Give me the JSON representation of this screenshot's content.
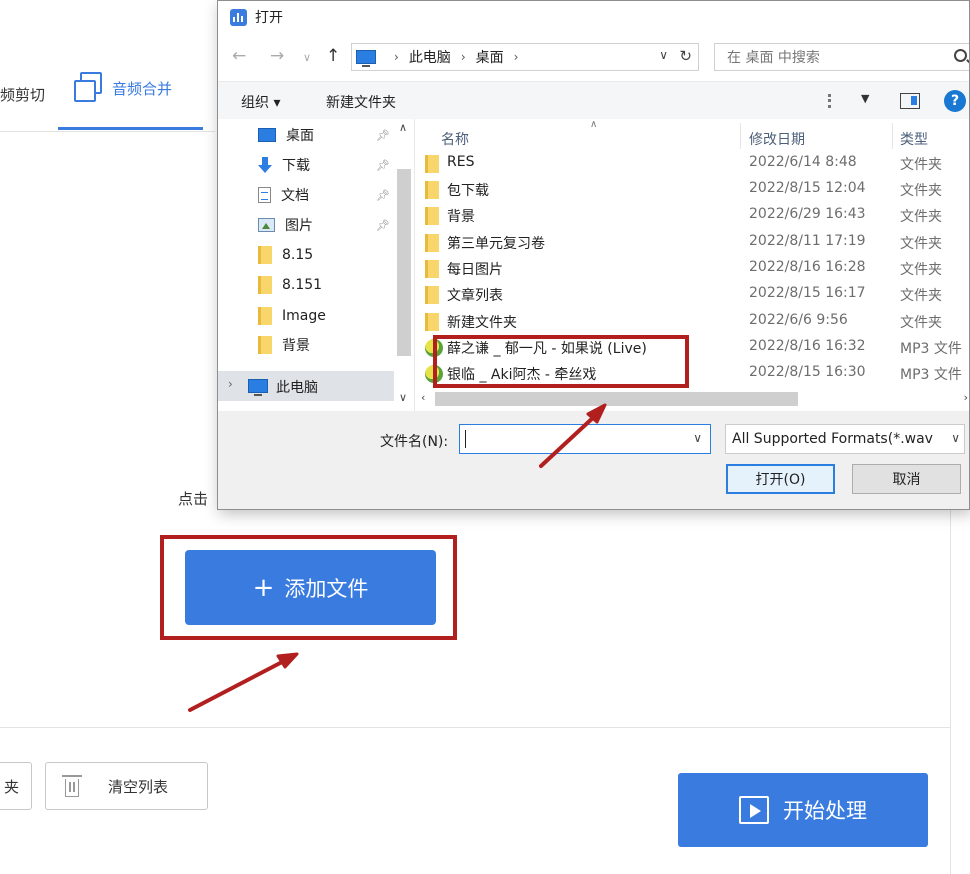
{
  "app": {
    "tab_left_label": "频剪切",
    "tab_merge_label": "音频合并",
    "click_hint": "点击",
    "add_file_label": "添加文件",
    "add_file_plus": "+",
    "folder_button_label": "夹",
    "clear_list_label": "清空列表",
    "start_label": "开始处理",
    "accent_color": "#3a7be0"
  },
  "dialog": {
    "title": "打开",
    "address": {
      "crumbs": [
        "此电脑",
        "桌面"
      ]
    },
    "search_placeholder": "在 桌面 中搜索",
    "toolbar": {
      "organize_label": "组织 ▾",
      "new_folder_label": "新建文件夹"
    },
    "nav_tree": [
      {
        "label": "桌面",
        "icon": "desktop-icon",
        "pinned": true
      },
      {
        "label": "下载",
        "icon": "download-icon",
        "pinned": true
      },
      {
        "label": "文档",
        "icon": "document-icon",
        "pinned": true
      },
      {
        "label": "图片",
        "icon": "pictures-icon",
        "pinned": true
      },
      {
        "label": "8.15",
        "icon": "folder-icon",
        "pinned": false
      },
      {
        "label": "8.151",
        "icon": "folder-icon",
        "pinned": false
      },
      {
        "label": "Image",
        "icon": "folder-icon",
        "pinned": false
      },
      {
        "label": "背景",
        "icon": "folder-icon",
        "pinned": false
      }
    ],
    "nav_this_pc": "此电脑",
    "columns": {
      "name": "名称",
      "modified": "修改日期",
      "type": "类型"
    },
    "files": [
      {
        "name": "RES",
        "modified": "2022/6/14 8:48",
        "type": "文件夹",
        "icon": "folder-icon"
      },
      {
        "name": "包下载",
        "modified": "2022/8/15 12:04",
        "type": "文件夹",
        "icon": "folder-icon"
      },
      {
        "name": "背景",
        "modified": "2022/6/29 16:43",
        "type": "文件夹",
        "icon": "folder-icon"
      },
      {
        "name": "第三单元复习卷",
        "modified": "2022/8/11 17:19",
        "type": "文件夹",
        "icon": "folder-icon"
      },
      {
        "name": "每日图片",
        "modified": "2022/8/16 16:28",
        "type": "文件夹",
        "icon": "folder-icon"
      },
      {
        "name": "文章列表",
        "modified": "2022/8/15 16:17",
        "type": "文件夹",
        "icon": "folder-icon"
      },
      {
        "name": "新建文件夹",
        "modified": "2022/6/6 9:56",
        "type": "文件夹",
        "icon": "folder-icon"
      },
      {
        "name": "薛之谦 _ 郁一凡 - 如果说 (Live)",
        "modified": "2022/8/16 16:32",
        "type": "MP3 文件",
        "icon": "mp3-icon"
      },
      {
        "name": "银临 _ Aki阿杰 - 牵丝戏",
        "modified": "2022/8/15 16:30",
        "type": "MP3 文件",
        "icon": "mp3-icon"
      }
    ],
    "filename_label": "文件名(N):",
    "filename_value": "",
    "format_label": "All Supported Formats(*.wav",
    "open_label": "打开(O)",
    "cancel_label": "取消"
  },
  "annotations": {
    "highlight_color": "#b21f1f"
  }
}
